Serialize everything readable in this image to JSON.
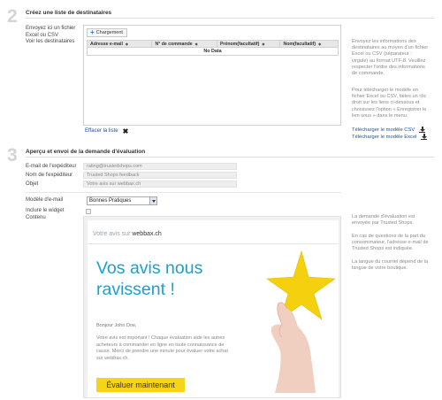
{
  "step2": {
    "number": "2",
    "title": "Créez une liste de destinataires",
    "labels": [
      "Envoyez ici un fichier",
      "Excel ou CSV",
      "Voir les destinataires"
    ],
    "upload_button": "Chargement",
    "columns": [
      "Adresse e-mail",
      "N° de commande",
      "Prénom(facultatif)",
      "Nom(facultatif)"
    ],
    "no_data": "No Data",
    "help_upload": [
      "Envoyez les informations des",
      "destinataires au moyen d'un fichier",
      "Excel ou CSV (séparateur :",
      "virgule) au format UTF-8. Veuillez",
      "respecter l'ordre des informations",
      "de commande."
    ],
    "help_template": [
      "Pour télécharger le modèle en",
      "fichier Excel ou CSV, faites un clic",
      "droit sur les liens ci-dessous et",
      "choisissez l'option « Enregistrer le",
      "lien sous » dans le menu."
    ],
    "clear_link": "Effacer la liste",
    "download_csv": "Télécharger le modèle CSV",
    "download_excel": "Télécharger le modèle Excel"
  },
  "step3": {
    "number": "3",
    "title": "Aperçu et envoi de la demande d'évaluation",
    "label_sender_email": "E-mail de l'expéditeur",
    "label_sender_name": "Nom de l'expéditeur",
    "label_subject": "Objet",
    "sender_email": "rating@trustedshops.com",
    "sender_name": "Trusted Shops feedback",
    "subject": "Votre avis sur webbax.ch",
    "label_template": "Modèle d'e-mail",
    "template_value": "Bonnes Pratiques",
    "label_widget": "Inclure le widget",
    "label_content": "Contenu",
    "help_sent": [
      "La demande d'évaluation est",
      "envoyée par Trusted Shops."
    ],
    "help_questions": [
      "En cas de questions de la part du",
      "consommateur, l'adresse e-mail de",
      "Trusted Shops est indiquée."
    ],
    "help_language": [
      "La langue du courriel dépend de la",
      "langue de votre boutique."
    ]
  },
  "email": {
    "header_prefix": "Votre avis sur ",
    "header_domain": "webbax.ch",
    "hero_line1": "Vos avis nous",
    "hero_line2": "ravissent !",
    "greeting": "Bonjour John Doe,",
    "body": [
      "Votre avis est important ! Chaque évaluation aide les autres",
      "acheteurs à commander en ligne en toute connaissance de",
      "cause. Merci de prendre une minute pour évaluer votre achat",
      "sur webbax.ch."
    ],
    "cta": "Évaluer maintenant"
  },
  "colors": {
    "link": "#1d4f9c",
    "hero": "#1aa1cf",
    "cta": "#f7d417",
    "star": "#f5d00f"
  }
}
